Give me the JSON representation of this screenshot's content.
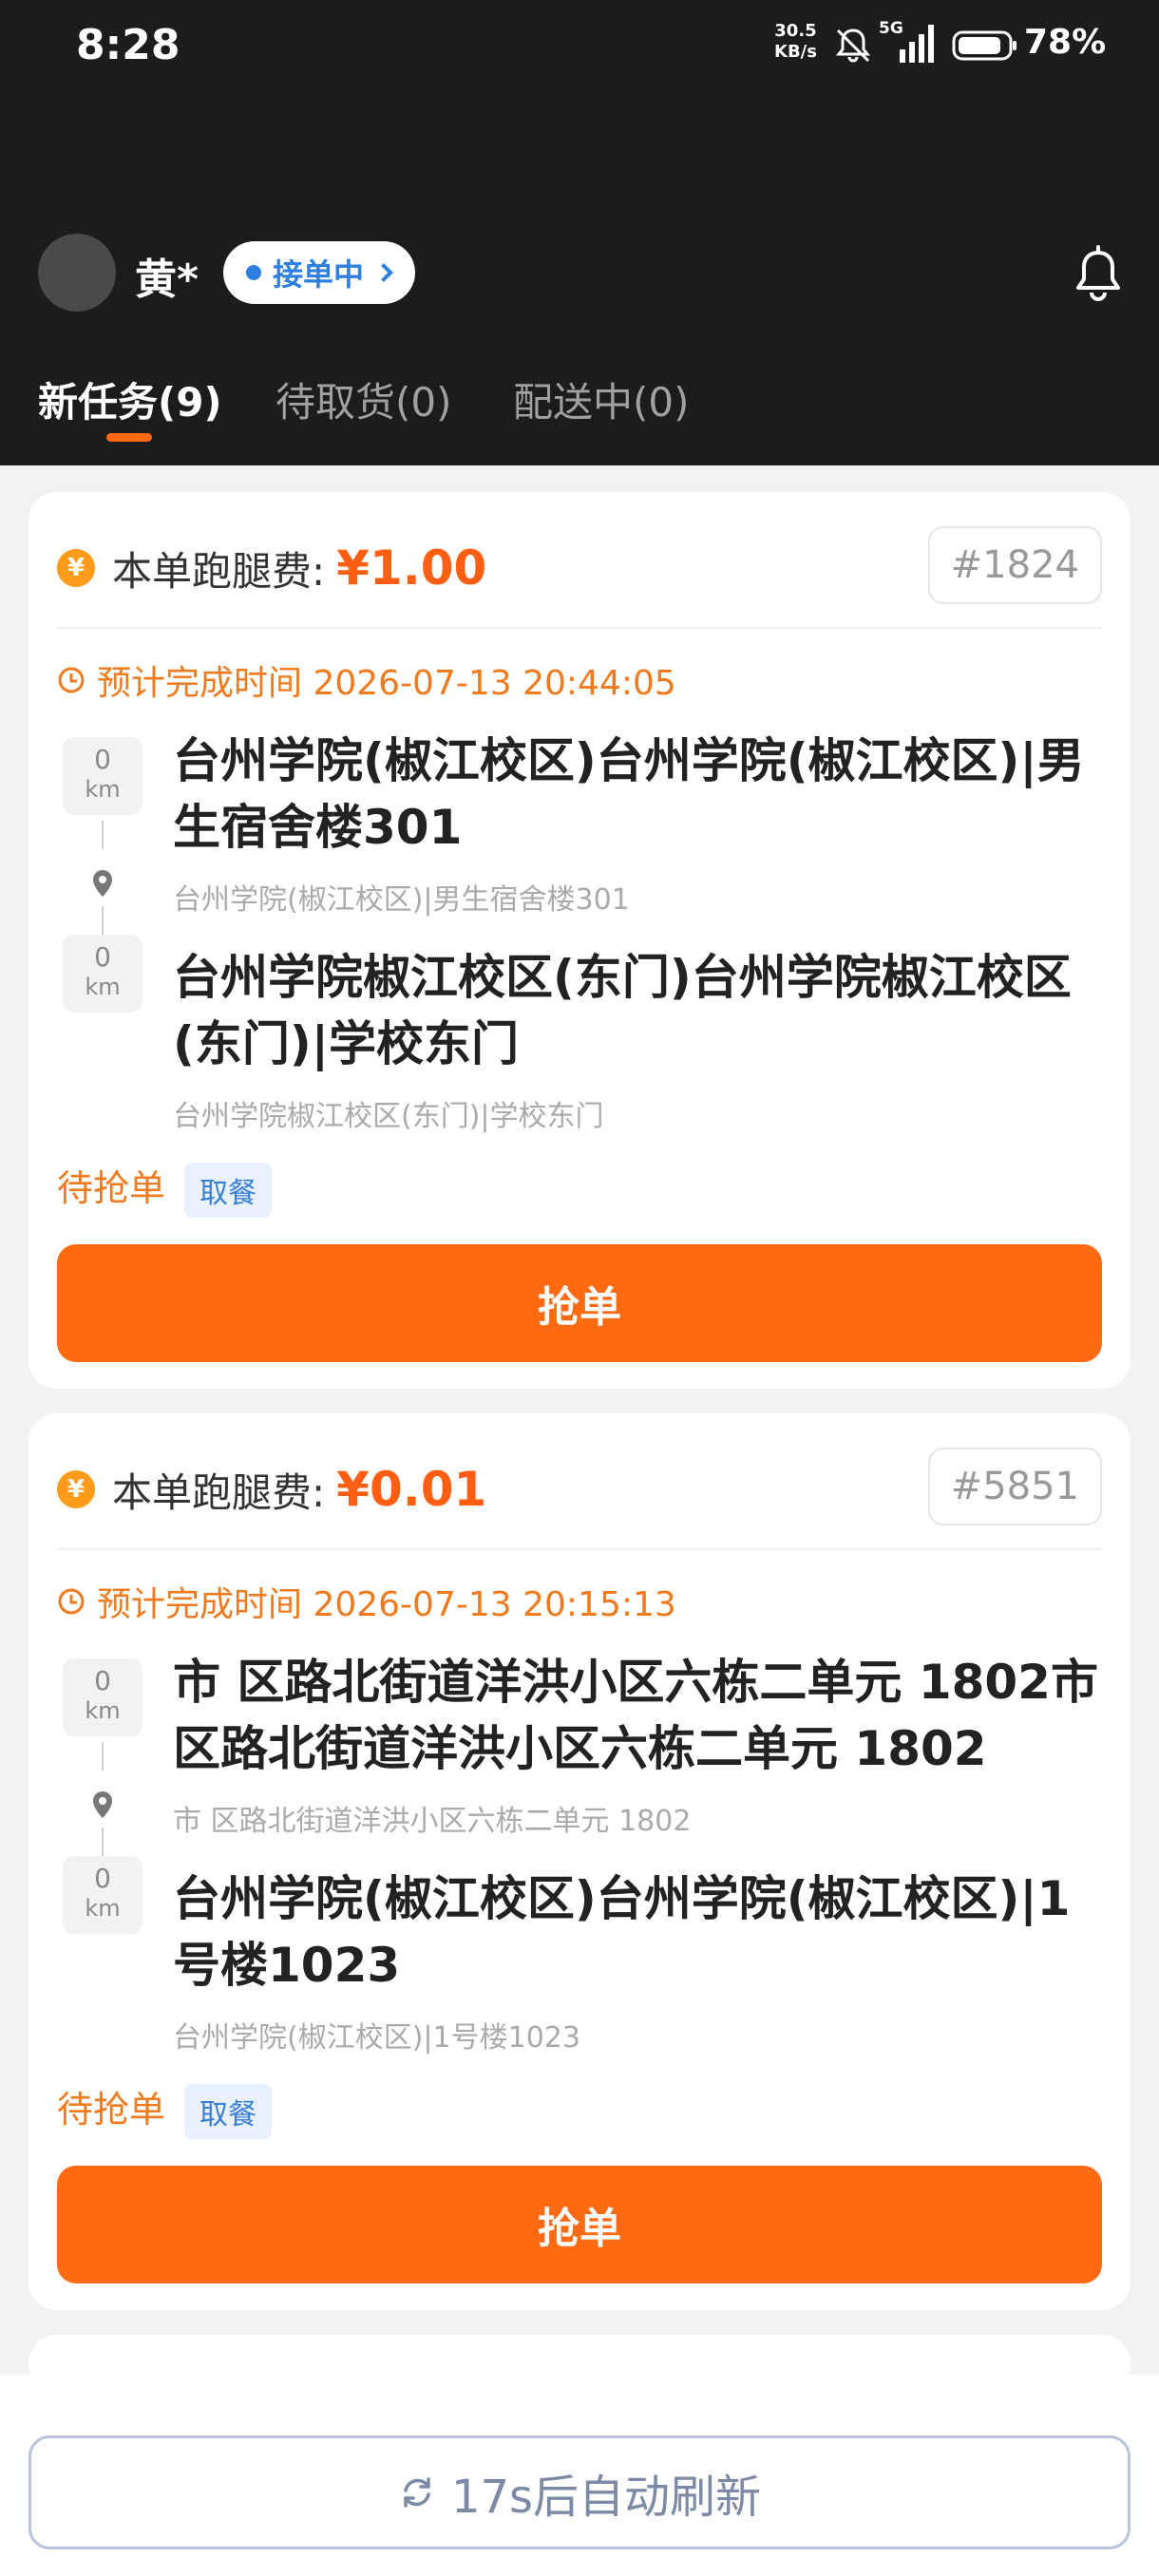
{
  "status_bar": {
    "time": "8:28",
    "speed_value": "30.5",
    "speed_unit": "KB/s",
    "network": "5G",
    "battery": "78%"
  },
  "header": {
    "user_name": "黄*",
    "status_label": "接单中",
    "tabs": [
      {
        "label": "新任务(9)",
        "active": true
      },
      {
        "label": "待取货(0)",
        "active": false
      },
      {
        "label": "配送中(0)",
        "active": false
      }
    ]
  },
  "cards": [
    {
      "fee_label": "本单跑腿费:",
      "fee_value": "¥1.00",
      "order_no": "#1824",
      "eta": "预计完成时间 2026-07-13 20:44:05",
      "pickup": {
        "km": "0",
        "km_unit": "km",
        "title": "台州学院(椒江校区)台州学院(椒江校区)|男生宿舍楼301",
        "subtitle": "台州学院(椒江校区)|男生宿舍楼301"
      },
      "dropoff": {
        "km": "0",
        "km_unit": "km",
        "title": "台州学院椒江校区(东门)台州学院椒江校区(东门)|学校东门",
        "subtitle": "台州学院椒江校区(东门)|学校东门"
      },
      "status": "待抢单",
      "tag": "取餐",
      "button": "抢单"
    },
    {
      "fee_label": "本单跑腿费:",
      "fee_value": "¥0.01",
      "order_no": "#5851",
      "eta": "预计完成时间 2026-07-13 20:15:13",
      "pickup": {
        "km": "0",
        "km_unit": "km",
        "title": "市 区路北街道洋洪小区六栋二单元 1802市 区路北街道洋洪小区六栋二单元 1802",
        "subtitle": "市 区路北街道洋洪小区六栋二单元 1802"
      },
      "dropoff": {
        "km": "0",
        "km_unit": "km",
        "title": "台州学院(椒江校区)台州学院(椒江校区)|1号楼1023",
        "subtitle": "台州学院(椒江校区)|1号楼1023"
      },
      "status": "待抢单",
      "tag": "取餐",
      "button": "抢单"
    }
  ],
  "bottom": {
    "refresh_label": "17s后自动刷新"
  },
  "colors": {
    "accent": "#ff6a13",
    "header_bg": "#1c1c1c",
    "status_blue": "#2f7fe0"
  }
}
